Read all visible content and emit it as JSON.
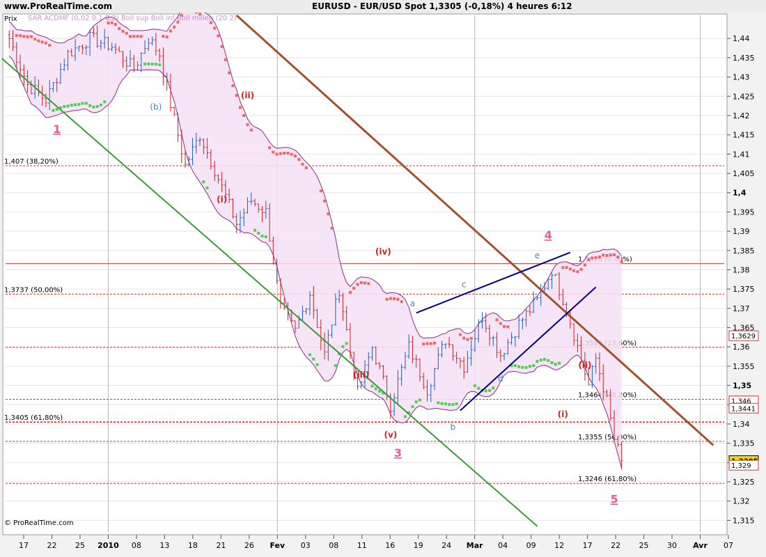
{
  "header": {
    "site": "www.ProRealTime.com",
    "title": "EURUSD - EUR/USD Spot    1,3305 (-0,18%)    4 heures  6:12"
  },
  "panel": {
    "label": "Prix",
    "legend": "SAR ACDMF (0,02 0,1 0,2)  Boll sup Boll inf Boll milieu (20 2)",
    "copyright": "© ProRealTime.com"
  },
  "colors": {
    "background": "#ffffff",
    "bull_candle": "#1f5fbf",
    "bear_candle": "#cc2222",
    "sar_up": "#55cc55",
    "sar_down": "#ee6666",
    "boll_band": "#8a2d8a",
    "boll_fill": "#f4e0f4",
    "fib_line": "#dd3333",
    "trend_green": "#3a9a3a",
    "trend_brown": "#a0522d",
    "wedge": "#000080",
    "wave_main": "#e0609c",
    "wave_minor": "#cc2222",
    "wave_abc": "#4a86c8",
    "last_price_bg": "#ffd700"
  },
  "chart_data": {
    "type": "candlestick",
    "instrument": "EURUSD - EUR/USD Spot",
    "timeframe": "4 heures",
    "y_range": [
      1.312,
      1.446
    ],
    "y_ticks": [
      "1,44",
      "1,435",
      "1,43",
      "1,425",
      "1,42",
      "1,415",
      "1,41",
      "1,405",
      "1,4",
      "1,395",
      "1,39",
      "1,385",
      "1,38",
      "1,375",
      "1,37",
      "1,365",
      "1,36",
      "1,355",
      "1,35",
      "1,345",
      "1,34",
      "1,335",
      "1,33",
      "1,325",
      "1,32",
      "1,315"
    ],
    "x_ticks": [
      "17",
      "22",
      "25",
      "2010",
      "08",
      "13",
      "18",
      "21",
      "26",
      "Fev",
      "03",
      "08",
      "11",
      "16",
      "19",
      "24",
      "Mar",
      "04",
      "09",
      "12",
      "17",
      "22",
      "25",
      "30",
      "Avr",
      "07"
    ],
    "price_path": [
      {
        "t": 0,
        "v": 1.44
      },
      {
        "t": 5,
        "v": 1.428
      },
      {
        "t": 10,
        "v": 1.424
      },
      {
        "t": 16,
        "v": 1.436
      },
      {
        "t": 22,
        "v": 1.44
      },
      {
        "t": 28,
        "v": 1.438
      },
      {
        "t": 34,
        "v": 1.432
      },
      {
        "t": 38,
        "v": 1.44
      },
      {
        "t": 41,
        "v": 1.436
      },
      {
        "t": 44,
        "v": 1.423
      },
      {
        "t": 48,
        "v": 1.407
      },
      {
        "t": 52,
        "v": 1.415
      },
      {
        "t": 56,
        "v": 1.406
      },
      {
        "t": 62,
        "v": 1.392
      },
      {
        "t": 66,
        "v": 1.398
      },
      {
        "t": 70,
        "v": 1.395
      },
      {
        "t": 74,
        "v": 1.37
      },
      {
        "t": 78,
        "v": 1.364
      },
      {
        "t": 82,
        "v": 1.374
      },
      {
        "t": 86,
        "v": 1.358
      },
      {
        "t": 90,
        "v": 1.375
      },
      {
        "t": 95,
        "v": 1.348
      },
      {
        "t": 99,
        "v": 1.36
      },
      {
        "t": 104,
        "v": 1.345
      },
      {
        "t": 109,
        "v": 1.36
      },
      {
        "t": 114,
        "v": 1.349
      },
      {
        "t": 119,
        "v": 1.362
      },
      {
        "t": 124,
        "v": 1.355
      },
      {
        "t": 129,
        "v": 1.368
      },
      {
        "t": 134,
        "v": 1.358
      },
      {
        "t": 139,
        "v": 1.366
      },
      {
        "t": 144,
        "v": 1.372
      },
      {
        "t": 148,
        "v": 1.38
      },
      {
        "t": 152,
        "v": 1.37
      },
      {
        "t": 155,
        "v": 1.36
      },
      {
        "t": 158,
        "v": 1.35
      },
      {
        "t": 160,
        "v": 1.357
      },
      {
        "t": 163,
        "v": 1.346
      },
      {
        "t": 165,
        "v": 1.336
      },
      {
        "t": 167,
        "v": 1.3305
      }
    ],
    "price_path_t_range": [
      0,
      167
    ],
    "fib_levels": [
      {
        "value": 1.407,
        "label": "1,407 (38,20%)",
        "pos": "left"
      },
      {
        "value": 1.3737,
        "label": "1,3737 (50,00%)",
        "pos": "left"
      },
      {
        "value": 1.3405,
        "label": "1,3405 (61,80%)",
        "pos": "left",
        "bold": true
      },
      {
        "value": 1.3816,
        "label": "1,3816 (0,00%)",
        "pos": "right",
        "solid": true
      },
      {
        "value": 1.3599,
        "label": "1,3599 (23,60%)",
        "pos": "right"
      },
      {
        "value": 1.3464,
        "label": "1,3464 (38,20%)",
        "pos": "right"
      },
      {
        "value": 1.3355,
        "label": "1,3355 (50,00%)",
        "pos": "right"
      },
      {
        "value": 1.3246,
        "label": "1,3246 (61,80%)",
        "pos": "right"
      }
    ],
    "trend_lines": [
      {
        "name": "green",
        "from": [
          -2,
          1.4348
        ],
        "to": [
          144,
          1.3135
        ]
      },
      {
        "name": "brown",
        "from": [
          62,
          1.446
        ],
        "to": [
          192,
          1.3345
        ]
      },
      {
        "name": "wedge-upper",
        "from": [
          111,
          1.3688
        ],
        "to": [
          153,
          1.3845
        ]
      },
      {
        "name": "wedge-lower",
        "from": [
          123,
          1.3435
        ],
        "to": [
          160,
          1.3755
        ]
      }
    ],
    "wave_labels": [
      {
        "text": "1",
        "t": 13,
        "v": 1.4155,
        "cls": "main"
      },
      {
        "text": "(b)",
        "t": 40,
        "v": 1.4215,
        "cls": "abc"
      },
      {
        "text": "(ii)",
        "t": 65,
        "v": 1.4245,
        "cls": "minor"
      },
      {
        "text": "(i)",
        "t": 58,
        "v": 1.3975,
        "cls": "minor"
      },
      {
        "text": "(iv)",
        "t": 102,
        "v": 1.384,
        "cls": "minor"
      },
      {
        "text": "(iii)",
        "t": 96,
        "v": 1.352,
        "cls": "minor"
      },
      {
        "text": "(v)",
        "t": 104,
        "v": 1.3365,
        "cls": "minor"
      },
      {
        "text": "3",
        "t": 106,
        "v": 1.3315,
        "cls": "main"
      },
      {
        "text": "a",
        "t": 110,
        "v": 1.3705,
        "cls": "abc"
      },
      {
        "text": "b",
        "t": 121,
        "v": 1.3385,
        "cls": "abc"
      },
      {
        "text": "c",
        "t": 124,
        "v": 1.3755,
        "cls": "abc"
      },
      {
        "text": "d",
        "t": 134,
        "v": 1.351,
        "cls": "abc"
      },
      {
        "text": "e",
        "t": 144,
        "v": 1.383,
        "cls": "abc"
      },
      {
        "text": "4",
        "t": 147,
        "v": 1.388,
        "cls": "main"
      },
      {
        "text": "(ii)",
        "t": 157,
        "v": 1.3545,
        "cls": "minor"
      },
      {
        "text": "(i)",
        "t": 151,
        "v": 1.3418,
        "cls": "minor"
      },
      {
        "text": "5",
        "t": 165,
        "v": 1.3195,
        "cls": "main"
      }
    ],
    "price_tags": [
      {
        "label": "1,3629",
        "value": 1.3629,
        "style": "white"
      },
      {
        "label": "1,346",
        "value": 1.346,
        "style": "white"
      },
      {
        "label": "1,3441",
        "value": 1.3441,
        "style": "white"
      },
      {
        "label": "1,3305",
        "value": 1.3305,
        "style": "gold"
      },
      {
        "label": "1,329",
        "value": 1.3293,
        "style": "white"
      }
    ]
  }
}
